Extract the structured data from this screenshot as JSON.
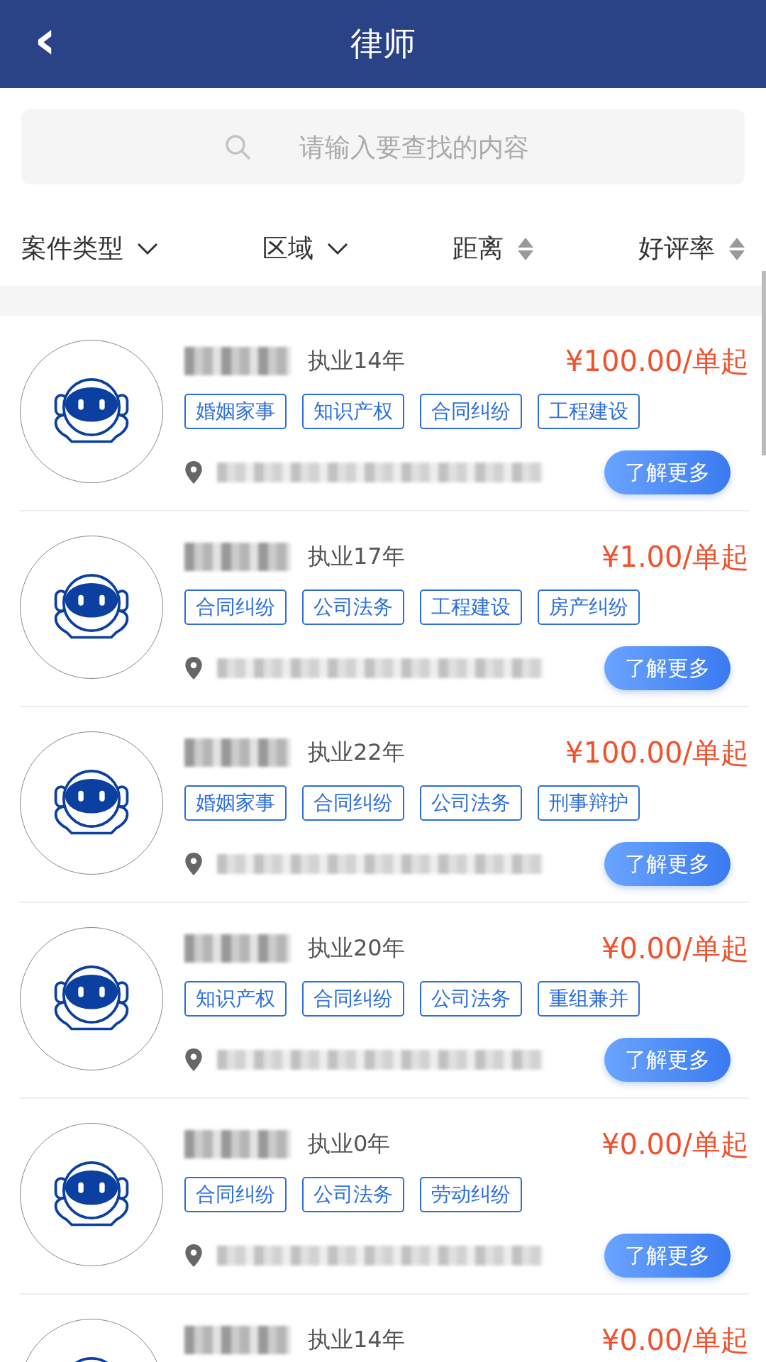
{
  "header": {
    "back_icon": "‹",
    "title": "律师"
  },
  "search": {
    "placeholder": "请输入要查找的内容"
  },
  "filters": [
    {
      "label": "案件类型",
      "kind": "dropdown"
    },
    {
      "label": "区域",
      "kind": "dropdown"
    },
    {
      "label": "距离",
      "kind": "sort"
    },
    {
      "label": "好评率",
      "kind": "sort"
    }
  ],
  "lawyers": [
    {
      "years": "执业14年",
      "price": "¥100.00/单起",
      "tags": [
        "婚姻家事",
        "知识产权",
        "合同纠纷",
        "工程建设"
      ],
      "button": "了解更多"
    },
    {
      "years": "执业17年",
      "price": "¥1.00/单起",
      "tags": [
        "合同纠纷",
        "公司法务",
        "工程建设",
        "房产纠纷"
      ],
      "button": "了解更多"
    },
    {
      "years": "执业22年",
      "price": "¥100.00/单起",
      "tags": [
        "婚姻家事",
        "合同纠纷",
        "公司法务",
        "刑事辩护"
      ],
      "button": "了解更多"
    },
    {
      "years": "执业20年",
      "price": "¥0.00/单起",
      "tags": [
        "知识产权",
        "合同纠纷",
        "公司法务",
        "重组兼并"
      ],
      "button": "了解更多"
    },
    {
      "years": "执业0年",
      "price": "¥0.00/单起",
      "tags": [
        "合同纠纷",
        "公司法务",
        "劳动纠纷"
      ],
      "button": "了解更多"
    },
    {
      "years": "执业14年",
      "price": "¥0.00/单起"
    }
  ]
}
